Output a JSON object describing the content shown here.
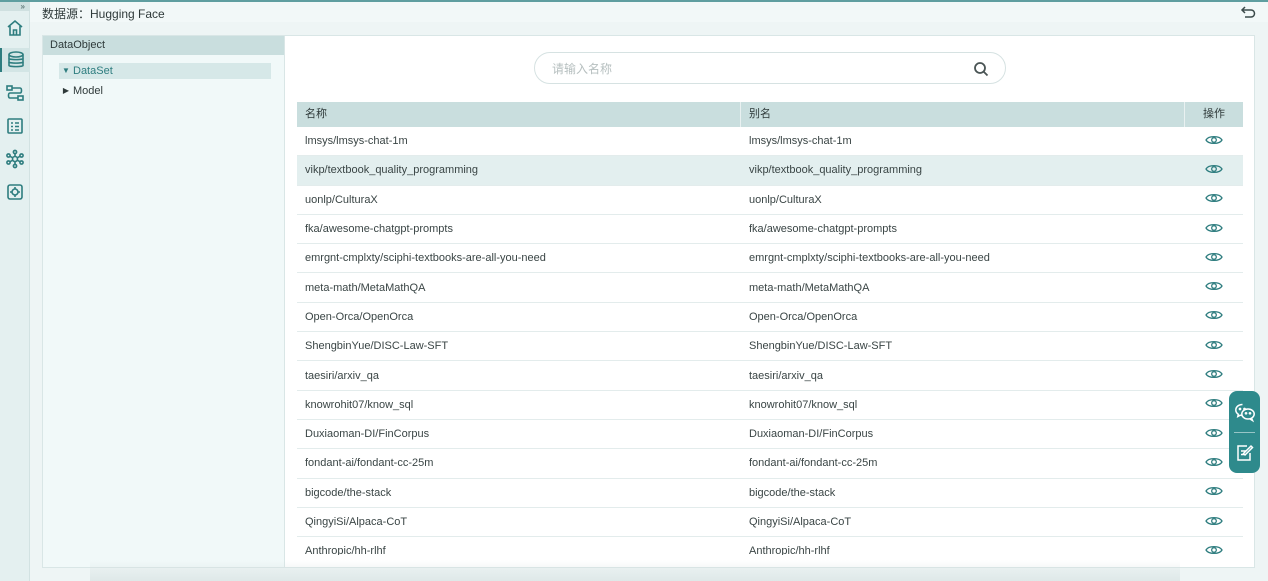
{
  "header": {
    "source_label": "数据源：Hugging Face"
  },
  "rail": {
    "expand_glyph": "»"
  },
  "tree": {
    "title": "DataObject",
    "nodes": [
      {
        "label": "DataSet",
        "expanded": true,
        "selected": true
      },
      {
        "label": "Model",
        "expanded": false,
        "selected": false
      }
    ]
  },
  "search": {
    "placeholder": "请输入名称",
    "value": ""
  },
  "table": {
    "headers": {
      "name": "名称",
      "alias": "别名",
      "action": "操作"
    },
    "rows": [
      {
        "name": "lmsys/lmsys-chat-1m",
        "alias": "lmsys/lmsys-chat-1m"
      },
      {
        "name": "vikp/textbook_quality_programming",
        "alias": "vikp/textbook_quality_programming"
      },
      {
        "name": "uonlp/CulturaX",
        "alias": "uonlp/CulturaX"
      },
      {
        "name": "fka/awesome-chatgpt-prompts",
        "alias": "fka/awesome-chatgpt-prompts"
      },
      {
        "name": "emrgnt-cmplxty/sciphi-textbooks-are-all-you-need",
        "alias": "emrgnt-cmplxty/sciphi-textbooks-are-all-you-need"
      },
      {
        "name": "meta-math/MetaMathQA",
        "alias": "meta-math/MetaMathQA"
      },
      {
        "name": "Open-Orca/OpenOrca",
        "alias": "Open-Orca/OpenOrca"
      },
      {
        "name": "ShengbinYue/DISC-Law-SFT",
        "alias": "ShengbinYue/DISC-Law-SFT"
      },
      {
        "name": "taesiri/arxiv_qa",
        "alias": "taesiri/arxiv_qa"
      },
      {
        "name": "knowrohit07/know_sql",
        "alias": "knowrohit07/know_sql"
      },
      {
        "name": "Duxiaoman-DI/FinCorpus",
        "alias": "Duxiaoman-DI/FinCorpus"
      },
      {
        "name": "fondant-ai/fondant-cc-25m",
        "alias": "fondant-ai/fondant-cc-25m"
      },
      {
        "name": "bigcode/the-stack",
        "alias": "bigcode/the-stack"
      },
      {
        "name": "QingyiSi/Alpaca-CoT",
        "alias": "QingyiSi/Alpaca-CoT"
      },
      {
        "name": "Anthropic/hh-rlhf",
        "alias": "Anthropic/hh-rlhf"
      }
    ]
  },
  "icons": {
    "rail": [
      "home-icon",
      "database-icon",
      "workflow-icon",
      "checklist-icon",
      "network-icon",
      "settings-icon"
    ],
    "back": "back-arrow-icon",
    "row_action": "eye-icon",
    "float": [
      "wechat-icon",
      "feedback-icon"
    ]
  },
  "colors": {
    "accent": "#2e7d7f",
    "header_bg": "#c9dede",
    "selected_row": "#e3efef"
  }
}
